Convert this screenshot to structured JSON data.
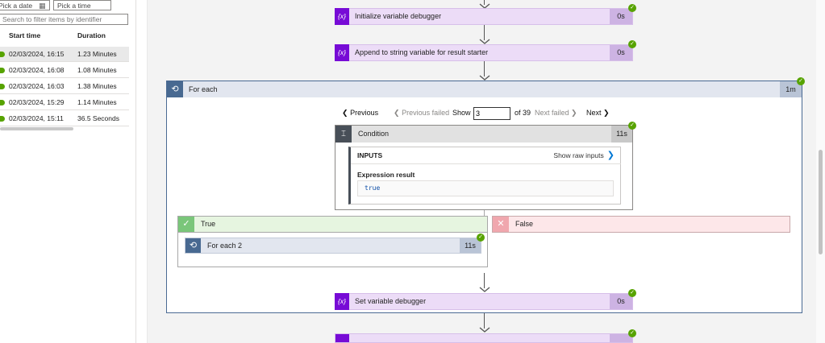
{
  "left_panel": {
    "date_placeholder": "Pick a date",
    "time_placeholder": "Pick a time",
    "filter_placeholder": "Search to filter items by identifier",
    "columns": {
      "start": "Start time",
      "duration": "Duration"
    },
    "runs": [
      {
        "start": "02/03/2024, 16:15",
        "duration": "1.23 Minutes",
        "status": "succeeded"
      },
      {
        "start": "02/03/2024, 16:08",
        "duration": "1.08 Minutes",
        "status": "succeeded"
      },
      {
        "start": "02/03/2024, 16:03",
        "duration": "1.38 Minutes",
        "status": "succeeded"
      },
      {
        "start": "02/03/2024, 15:29",
        "duration": "1.14 Minutes",
        "status": "succeeded"
      },
      {
        "start": "02/03/2024, 15:11",
        "duration": "36.5 Seconds",
        "status": "succeeded"
      }
    ]
  },
  "flow": {
    "init_var": {
      "label": "Initialize variable debugger",
      "duration": "0s",
      "icon": "{x}"
    },
    "append_var": {
      "label": "Append to string variable for result starter",
      "duration": "0s",
      "icon": "{x}"
    },
    "foreach": {
      "label": "For each",
      "duration": "1m"
    },
    "pager": {
      "previous": "Previous",
      "previous_failed": "Previous failed",
      "show": "Show",
      "current": "3",
      "of_total": "of 39",
      "next_failed": "Next failed",
      "next": "Next"
    },
    "condition": {
      "label": "Condition",
      "duration": "11s",
      "inputs_title": "INPUTS",
      "raw_inputs": "Show raw inputs",
      "expression_label": "Expression result",
      "expression_value": "true"
    },
    "true_branch": {
      "label": "True"
    },
    "false_branch": {
      "label": "False"
    },
    "foreach2": {
      "label": "For each 2",
      "duration": "11s"
    },
    "set_var": {
      "label": "Set variable debugger",
      "duration": "0s",
      "icon": "{x}"
    }
  },
  "colors": {
    "variable_action": "#770bd6",
    "foreach": "#486991",
    "success": "#57a300",
    "true_branch": "#e6f5e0",
    "false_branch": "#fde7e9",
    "link": "#0078d4"
  }
}
